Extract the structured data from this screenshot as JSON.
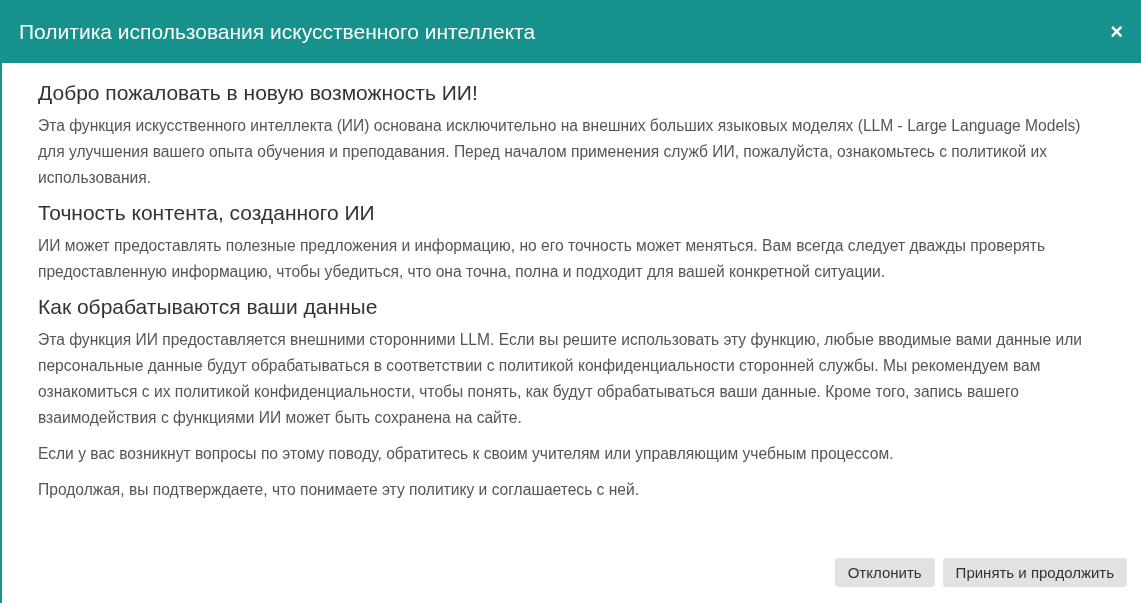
{
  "dialog": {
    "title": "Политика использования искусственного интеллекта",
    "close": "×"
  },
  "sections": [
    {
      "heading": "Добро пожаловать в новую возможность ИИ!",
      "paragraphs": [
        "Эта функция искусственного интеллекта (ИИ) основана исключительно на внешних больших языковых моделях (LLM - Large Language Models) для улучшения вашего опыта обучения и преподавания. Перед началом применения служб ИИ, пожалуйста, ознакомьтесь с политикой их использования."
      ]
    },
    {
      "heading": "Точность контента, созданного ИИ",
      "paragraphs": [
        "ИИ может предоставлять полезные предложения и информацию, но его точность может меняться. Вам всегда следует дважды проверять предоставленную информацию, чтобы убедиться, что она точна, полна и подходит для вашей конкретной ситуации."
      ]
    },
    {
      "heading": "Как обрабатываются ваши данные",
      "paragraphs": [
        "Эта функция ИИ предоставляется внешними сторонними LLM. Если вы решите использовать эту функцию, любые вводимые вами данные или персональные данные будут обрабатываться в соответствии с политикой конфиденциальности сторонней службы. Мы рекомендуем вам ознакомиться с их политикой конфиденциальности, чтобы понять, как будут обрабатываться ваши данные. Кроме того, запись вашего взаимодействия с функциями ИИ может быть сохранена на сайте.",
        "Если у вас возникнут вопросы по этому поводу, обратитесь к своим учителям или управляющим учебным процессом.",
        "Продолжая, вы подтверждаете, что понимаете эту политику и соглашаетесь с ней."
      ]
    }
  ],
  "buttons": [
    "Отклонить",
    "Принять и продолжить"
  ]
}
